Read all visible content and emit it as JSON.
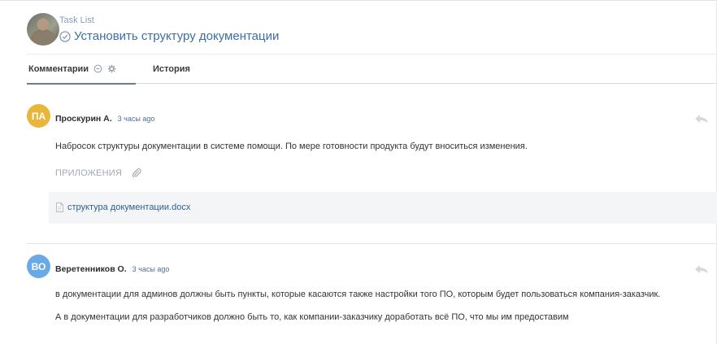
{
  "header": {
    "breadcrumb": "Task List",
    "title": "Установить структуру документации"
  },
  "tabs": {
    "comments_label": "Комментарии",
    "history_label": "История"
  },
  "comments": [
    {
      "initials": "ПА",
      "avatar_color": "#e8b63a",
      "author": "Проскурин А.",
      "time": "3 часы ago",
      "paragraphs": [
        "Набросок структуры документации в системе помощи. По мере готовности продукта будут вноситься изменения."
      ],
      "attachments_title": "ПРИЛОЖЕНИЯ",
      "attachments": [
        {
          "name": "структура документации.docx",
          "icon": "document-icon"
        }
      ]
    },
    {
      "initials": "ВО",
      "avatar_color": "#69a9e6",
      "author": "Веретенников О.",
      "time": "3 часы ago",
      "paragraphs": [
        "в документации для админов должны быть пункты, которые касаются также настройки того ПО, которым будет пользоваться компания-заказчик.",
        "А в документации для разработчиков должно быть то, как компании-заказчику доработать всё ПО, что мы им предоставим"
      ]
    }
  ],
  "colors": {
    "link": "#2d5f93",
    "title": "#3c6ea8",
    "tab_underline": "#6d7d90"
  }
}
